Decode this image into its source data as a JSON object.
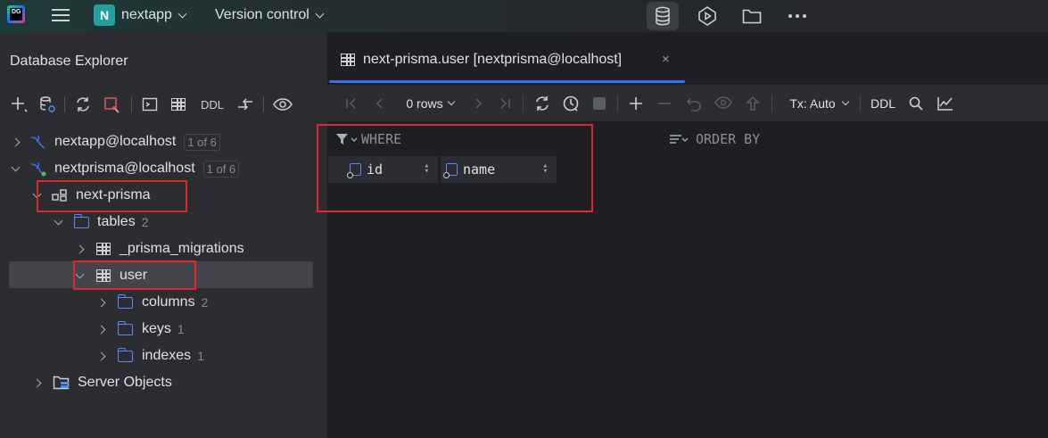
{
  "topbar": {
    "logo_text": "DG",
    "project_badge": "N",
    "project_name": "nextapp",
    "version_control": "Version control",
    "icons": [
      "database-icon",
      "run-icon",
      "folder-icon",
      "more-icon"
    ]
  },
  "explorer": {
    "title": "Database Explorer",
    "toolbar": {
      "ddl": "DDL"
    },
    "tree": {
      "conn1": {
        "label": "nextapp@localhost",
        "badge": "1 of 6"
      },
      "conn2": {
        "label": "nextprisma@localhost",
        "badge": "1 of 6"
      },
      "schema": {
        "label": "next-prisma"
      },
      "tables": {
        "label": "tables",
        "count": "2"
      },
      "migrations": {
        "label": "_prisma_migrations"
      },
      "user": {
        "label": "user"
      },
      "columns": {
        "label": "columns",
        "count": "2"
      },
      "keys": {
        "label": "keys",
        "count": "1"
      },
      "indexes": {
        "label": "indexes",
        "count": "1"
      },
      "server_objects": {
        "label": "Server Objects"
      }
    }
  },
  "editor": {
    "tab_label": "next-prisma.user [nextprisma@localhost]",
    "tab_close": "×",
    "toolbar": {
      "rows": "0 rows",
      "tx": "Tx: Auto",
      "ddl": "DDL"
    },
    "filter": {
      "where": "WHERE",
      "order_by": "ORDER BY",
      "columns": [
        "id",
        "name"
      ]
    }
  },
  "colors": {
    "accent": "#3574f0",
    "highlight_box": "#e3262b",
    "folder": "#548af7",
    "project_badge": "#21a0a0"
  }
}
